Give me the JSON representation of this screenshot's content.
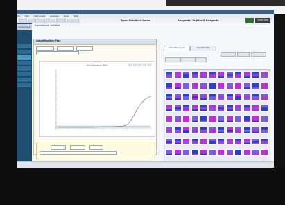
{
  "window": {
    "menu": [
      "File",
      "Edit",
      "Instrument",
      "Analysis",
      "Tools",
      "Help"
    ]
  },
  "experiment": {
    "name_label": "Experiment: Untitled",
    "type_label": "Type: Standard Curve",
    "reagents_label": "Reagents: TaqMan® Reagents",
    "run_button": "START RUN"
  },
  "sidebar": {
    "header": "Experiment Menu"
  },
  "amplification": {
    "title": "Amplification Plot",
    "plot_title": "Amplification Plot"
  },
  "plate": {
    "tabs": [
      "View Plate Layout",
      "View Well Table"
    ]
  },
  "colors": {
    "well_blue": "#2b3fd0",
    "well_magenta": "#c22bd6",
    "well_violet": "#7b5ce0",
    "sidebar": "#1f4e6e",
    "curve": "#8a8a8a",
    "threshold": "#77aacc"
  },
  "chart_data": {
    "type": "line",
    "title": "Amplification Plot",
    "xlabel": "",
    "ylabel": "",
    "x": [
      1,
      4,
      8,
      12,
      16,
      20,
      24,
      28,
      30,
      32,
      34,
      36,
      38,
      40
    ],
    "series": [
      {
        "values": [
          0.02,
          0.02,
          0.02,
          0.02,
          0.02,
          0.03,
          0.03,
          0.04,
          0.08,
          0.22,
          0.45,
          0.64,
          0.76,
          0.82
        ]
      }
    ],
    "threshold": 0.05,
    "xlim": [
      0,
      40
    ],
    "ylim": [
      0,
      1.5
    ],
    "grid": false
  }
}
